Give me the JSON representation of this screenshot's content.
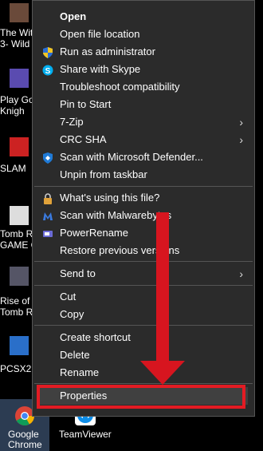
{
  "desktop": {
    "icons": [
      {
        "label": "The Wit\n3- Wild"
      },
      {
        "label": "Play Go\nKnigh"
      },
      {
        "label": "SLAM"
      },
      {
        "label": "Tomb Ra\nGAME C"
      },
      {
        "label": "Rise of\nTomb Ra"
      },
      {
        "label": "PCSX2"
      },
      {
        "label": "Google\nChrome"
      },
      {
        "label": "TeamViewer"
      }
    ]
  },
  "menu": {
    "items": [
      {
        "label": "Open",
        "bold": true
      },
      {
        "label": "Open file location"
      },
      {
        "label": "Run as administrator",
        "icon": "shield-icon"
      },
      {
        "label": "Share with Skype",
        "icon": "skype-icon"
      },
      {
        "label": "Troubleshoot compatibility"
      },
      {
        "label": "Pin to Start"
      },
      {
        "label": "7-Zip",
        "submenu": true
      },
      {
        "label": "CRC SHA",
        "submenu": true
      },
      {
        "label": "Scan with Microsoft Defender...",
        "icon": "defender-icon"
      },
      {
        "label": "Unpin from taskbar"
      },
      {
        "label": "What's using this file?",
        "icon": "lock-icon"
      },
      {
        "label": "Scan with Malwarebytes",
        "icon": "malwarebytes-icon"
      },
      {
        "label": "PowerRename",
        "icon": "powerrename-icon"
      },
      {
        "label": "Restore previous versions"
      },
      {
        "label": "Send to",
        "submenu": true
      },
      {
        "label": "Cut"
      },
      {
        "label": "Copy"
      },
      {
        "label": "Create shortcut"
      },
      {
        "label": "Delete"
      },
      {
        "label": "Rename"
      },
      {
        "label": "Properties"
      }
    ]
  },
  "colors": {
    "annotation": "#e31b23",
    "menu_bg": "#2b2b2b",
    "highlight": "#404040"
  }
}
